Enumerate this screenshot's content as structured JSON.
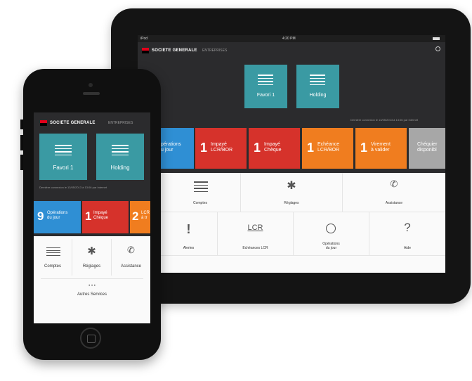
{
  "colors": {
    "brand_red": "#e2001a",
    "teal": "#3a9aa3",
    "blue": "#2f8fd4",
    "red": "#d6322b",
    "orange": "#f07d1f",
    "gray": "#a7a7a7",
    "dark": "#2b2b2d"
  },
  "tablet": {
    "status": {
      "device": "iPod",
      "time": "4:20 PM"
    },
    "header": {
      "brand": "SOCIETE GENERALE",
      "sub": "ENTREPRISES"
    },
    "favorites": [
      {
        "label": "Favori 1",
        "icon": "list-icon"
      },
      {
        "label": "Holding",
        "icon": "list-icon"
      }
    ],
    "last_connection": "Dernière connexion le 13/05/2013 à 13:06 par Internet",
    "tiles": [
      {
        "num": "",
        "label": "pérations\nu jour",
        "color": "blue"
      },
      {
        "num": "1",
        "label": "Impayé\nLCR/BOR",
        "color": "red"
      },
      {
        "num": "1",
        "label": "Impayé\nChèque",
        "color": "red"
      },
      {
        "num": "1",
        "label": "Echéance\nLCR/BOR",
        "color": "orange"
      },
      {
        "num": "1",
        "label": "Virement\nà valider",
        "color": "orange"
      },
      {
        "num": "",
        "label": "Chéquier\ndisponibl",
        "color": "gray"
      }
    ],
    "grid_row1": [
      {
        "label": "Comptes",
        "icon": "list-icon"
      },
      {
        "label": "Réglages",
        "icon": "gear-icon"
      },
      {
        "label": "Assistance",
        "icon": "phone-icon"
      }
    ],
    "grid_row2": [
      {
        "label": "Alertes",
        "icon": "exclamation-icon"
      },
      {
        "label": "Echéances LCR",
        "icon": "lcr-icon",
        "icon_text": "LCR"
      },
      {
        "label": "Opérations\ndu jour",
        "icon": "clock-icon"
      },
      {
        "label": "Aide",
        "icon": "question-icon",
        "icon_text": "?"
      }
    ]
  },
  "phone": {
    "header": {
      "brand": "SOCIETE GENERALE",
      "sub": "ENTREPRISES"
    },
    "favorites": [
      {
        "label": "Favori 1",
        "icon": "list-icon"
      },
      {
        "label": "Holding",
        "icon": "list-icon"
      }
    ],
    "last_connection": "Dernière connexion le 13/05/2013 à 13:06 par Internet",
    "tiles": [
      {
        "num": "9",
        "label": "Opérations\ndu jour",
        "color": "blue"
      },
      {
        "num": "1",
        "label": "Impayé\nChèque",
        "color": "red"
      },
      {
        "num": "2",
        "label": "LCR\nà tr",
        "color": "orange"
      }
    ],
    "menu": [
      {
        "label": "Comptes",
        "icon": "list-icon"
      },
      {
        "label": "Réglages",
        "icon": "gear-icon"
      },
      {
        "label": "Assistance",
        "icon": "phone-icon"
      }
    ],
    "more": {
      "label": "Autres Services",
      "icon": "more-dots-icon",
      "dots": "• • •"
    }
  }
}
